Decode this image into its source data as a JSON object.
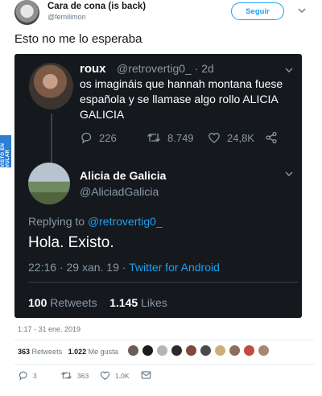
{
  "watermark": "VISTO EN VULAR",
  "author": {
    "name": "Cara de cona (is back)",
    "handle": "@femilimon"
  },
  "follow_button": "Seguir",
  "tweet_text": "Esto no me lo esperaba",
  "quoted": {
    "first": {
      "name": "roux",
      "handle": "@retrovertig0_ · 2d",
      "text": "os imagináis que hannah montana fuese española y se llamase algo rollo ALICIA GALICIA",
      "replies": "226",
      "retweets": "8.749",
      "likes": "24,8K"
    },
    "reply": {
      "name": "Alicia de Galicia",
      "handle": "@AliciadGalicia",
      "replying_prefix": "Replying to ",
      "replying_handle": "@retrovertig0_",
      "text": "Hola. Existo.",
      "time": "22:16 · 29 xan. 19 · ",
      "source": "Twitter for Android",
      "retweets_count": "100",
      "retweets_label": "Retweets",
      "likes_count": "1.145",
      "likes_label": "Likes"
    }
  },
  "date": "1:17 - 31 ene. 2019",
  "stats": {
    "retweets_count": "363",
    "retweets_label": "Retweets",
    "likes_count": "1.022",
    "likes_label": "Me gusta"
  },
  "liker_colors": [
    "#6b5d55",
    "#1b1b1b",
    "#b3b6b9",
    "#2a2a2a",
    "#7b4b3c",
    "#4a4a4a",
    "#c9b07a",
    "#8f6e5d",
    "#c44a40",
    "#a88676"
  ],
  "actions": {
    "replies": "3",
    "retweets": "363",
    "likes": "1,0K"
  }
}
